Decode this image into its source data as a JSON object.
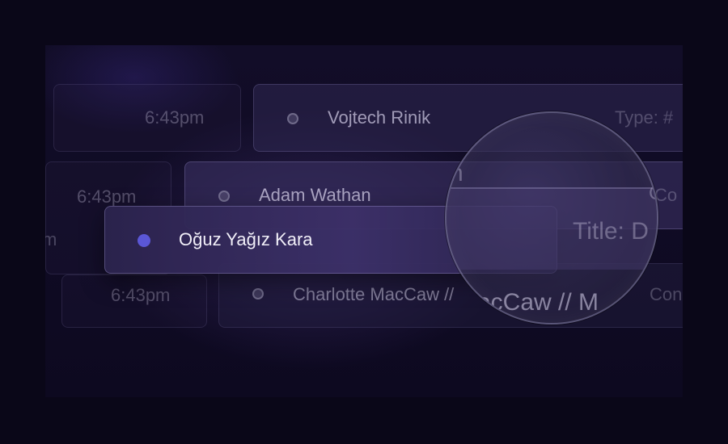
{
  "rows": {
    "row1": {
      "time": "6:43pm",
      "name": "Vojtech Rinik",
      "meta": "Type: #"
    },
    "row2": {
      "time": "6:43pm",
      "name": "Adam Wathan",
      "meta": "Co"
    },
    "row3": {
      "left_partial": "m",
      "name": "Oğuz Yağız Kara",
      "meta": "Title: D"
    },
    "row4": {
      "time": "6:43pm",
      "name": "Charlotte MacCaw //",
      "meta": "Con"
    }
  },
  "magnifier": {
    "top_partial": "n",
    "title": "Title: D",
    "caw": "acCaw // M",
    "right": "Co"
  },
  "colors": {
    "active_dot": "#5b57d6",
    "background": "#0a0718"
  }
}
